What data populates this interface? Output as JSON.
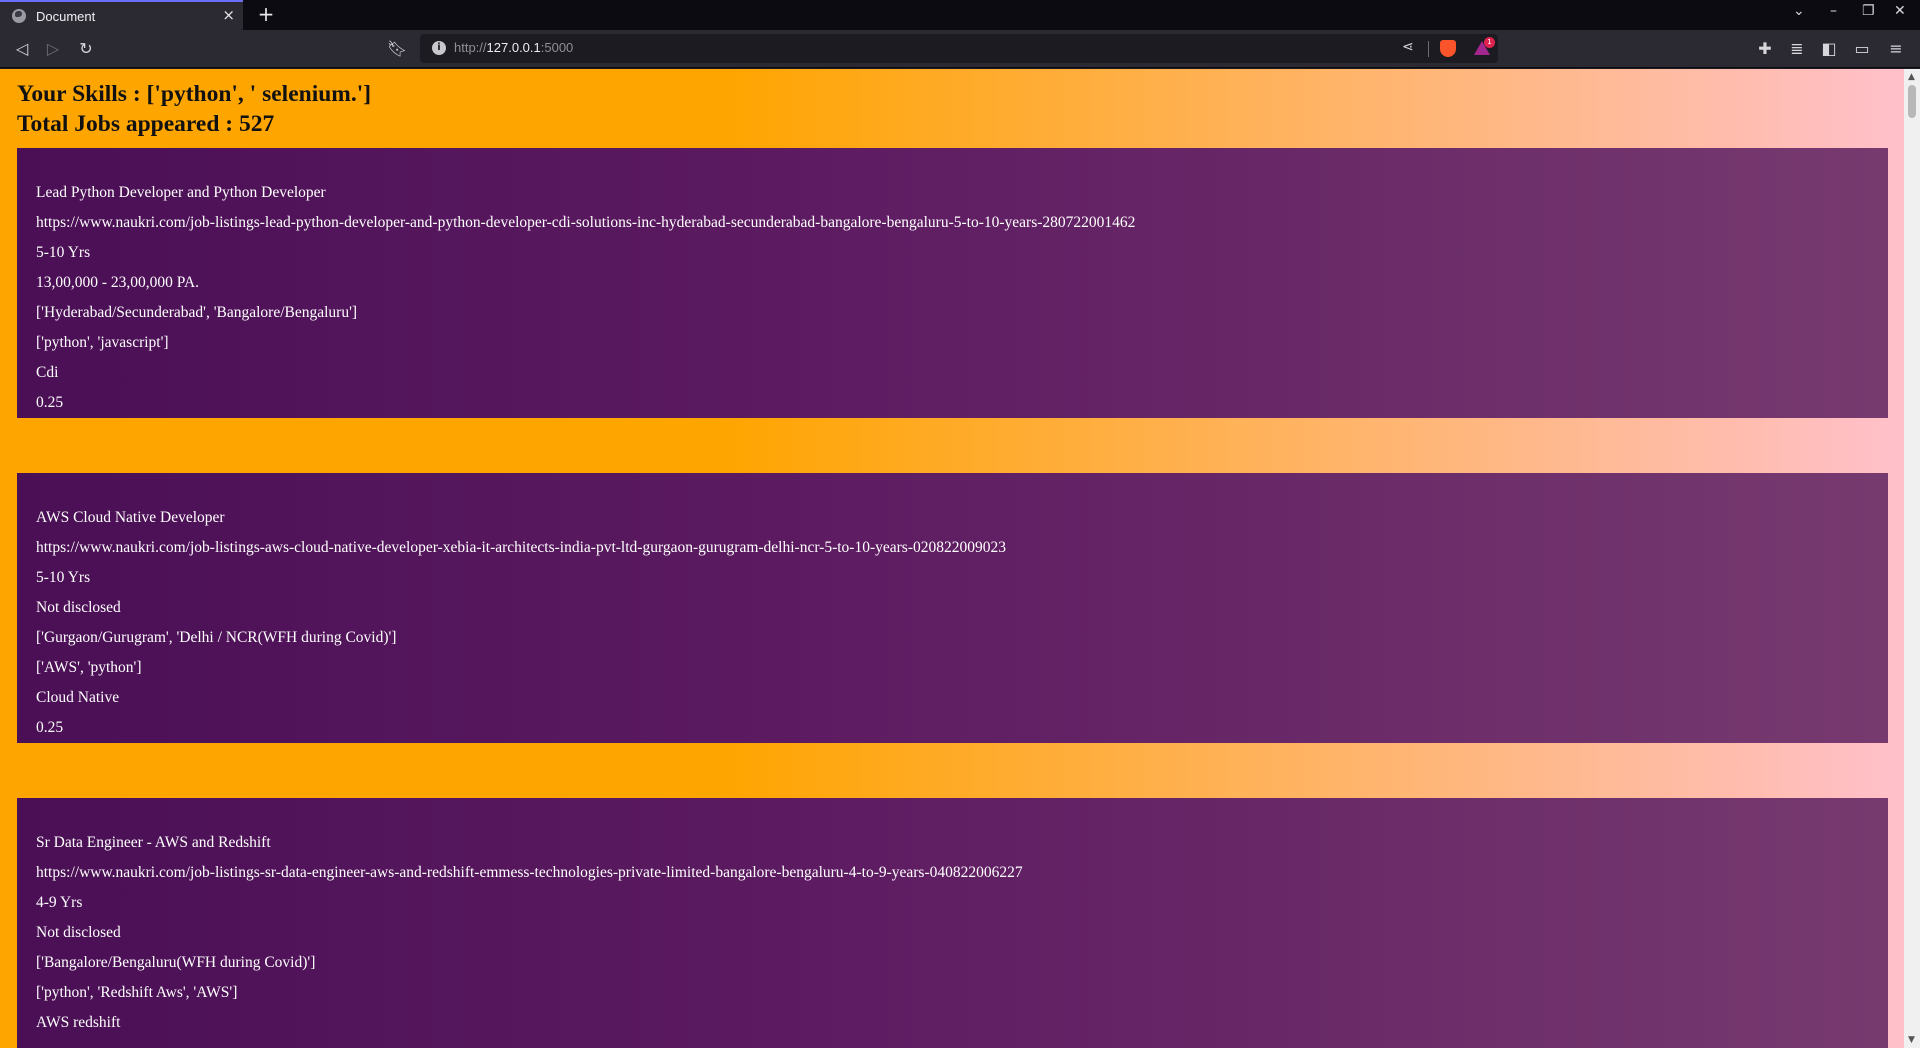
{
  "browser": {
    "tab_title": "Document",
    "url_scheme": "http://",
    "url_host": "127.0.0.1",
    "url_port": ":5000",
    "rewards_count": "1"
  },
  "page": {
    "skills_line": "Your Skills : ['python', ' selenium.']",
    "total_line": "Total Jobs appeared : 527"
  },
  "jobs": [
    {
      "title": "Lead Python Developer and Python Developer",
      "link": "https://www.naukri.com/job-listings-lead-python-developer-and-python-developer-cdi-solutions-inc-hyderabad-secunderabad-bangalore-bengaluru-5-to-10-years-280722001462",
      "experience": "5-10 Yrs",
      "salary": "13,00,000 - 23,00,000 PA.",
      "locations": "['Hyderabad/Secunderabad', 'Bangalore/Bengaluru']",
      "skills": "['python', 'javascript']",
      "company": "Cdi",
      "score": "0.25"
    },
    {
      "title": "AWS Cloud Native Developer",
      "link": "https://www.naukri.com/job-listings-aws-cloud-native-developer-xebia-it-architects-india-pvt-ltd-gurgaon-gurugram-delhi-ncr-5-to-10-years-020822009023",
      "experience": "5-10 Yrs",
      "salary": "Not disclosed",
      "locations": "['Gurgaon/Gurugram', 'Delhi / NCR(WFH during Covid)']",
      "skills": "['AWS', 'python']",
      "company": "Cloud Native",
      "score": "0.25"
    },
    {
      "title": "Sr Data Engineer - AWS and Redshift",
      "link": "https://www.naukri.com/job-listings-sr-data-engineer-aws-and-redshift-emmess-technologies-private-limited-bangalore-bengaluru-4-to-9-years-040822006227",
      "experience": "4-9 Yrs",
      "salary": "Not disclosed",
      "locations": "['Bangalore/Bengaluru(WFH during Covid)']",
      "skills": "['python', 'Redshift Aws', 'AWS']",
      "company": "AWS redshift",
      "score": ""
    }
  ]
}
